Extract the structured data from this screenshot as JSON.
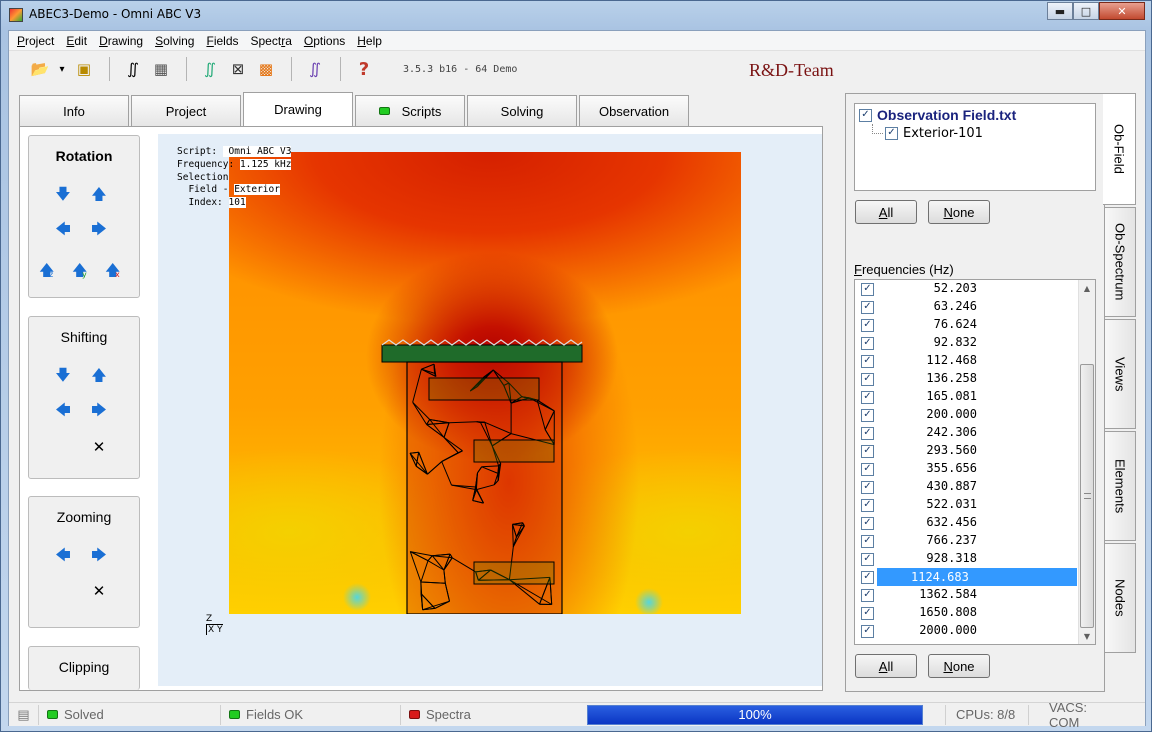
{
  "window": {
    "title": "ABEC3-Demo - Omni ABC V3",
    "controls": {
      "minimize": "▬",
      "maximize": "□",
      "close": "✕"
    }
  },
  "menu": [
    {
      "pre": "",
      "u": "P",
      "post": "roject"
    },
    {
      "pre": "",
      "u": "E",
      "post": "dit"
    },
    {
      "pre": "",
      "u": "D",
      "post": "rawing"
    },
    {
      "pre": "",
      "u": "S",
      "post": "olving"
    },
    {
      "pre": "",
      "u": "F",
      "post": "ields"
    },
    {
      "pre": "Spect",
      "u": "r",
      "post": "a"
    },
    {
      "pre": "",
      "u": "O",
      "post": "ptions"
    },
    {
      "pre": "",
      "u": "H",
      "post": "elp"
    }
  ],
  "toolbar": {
    "icons": [
      "open-folder-icon",
      "dropdown-icon",
      "save-icon",
      "integrate-icon",
      "mesh-icon",
      "spectra-icon",
      "grid-icon",
      "field-color-icon",
      "solve-curve-icon",
      "help-icon"
    ],
    "glyphs": {
      "open": "📂",
      "dropdown": "▾",
      "save": "▣",
      "integrate": "∬",
      "mesh": "▦",
      "spectra": "∬",
      "grid": "⊠",
      "field": "▩",
      "solve": "∬",
      "help": "?"
    },
    "version": "3.5.3 b16 - 64 Demo",
    "brand": "R&D-Team"
  },
  "tabs": [
    "Info",
    "Project",
    "Drawing",
    "Scripts",
    "Solving",
    "Observation"
  ],
  "active_tab": "Drawing",
  "controls": {
    "rotation": {
      "title": "Rotation",
      "up": "🡇",
      "down": "🡅",
      "left": "🡄",
      "right": "🡆",
      "axes": [
        "z",
        "y",
        "x"
      ],
      "axis_glyph": "🡅"
    },
    "shifting": {
      "title": "Shifting",
      "reset": "✕"
    },
    "zooming": {
      "title": "Zooming",
      "reset": "✕"
    },
    "clipping": {
      "title": "Clipping"
    }
  },
  "viewport": {
    "script_label": "Script:",
    "script_value": " Omni ABC V3",
    "frequency_label": "Frequency:",
    "frequency_value": "1.125 kHz",
    "selection_label": "Selection",
    "field_label": "  Field - ",
    "field_value": "Exterior",
    "index_label": "  Index:",
    "index_value": "101",
    "axis_z": "Z",
    "axis_xy": "X Y"
  },
  "observation": {
    "root": "Observation Field.txt",
    "child": "Exterior-101",
    "all_u": "A",
    "all_rest": "ll",
    "none_u": "N",
    "none_rest": "one"
  },
  "frequencies": {
    "label": "Frequencies  (Hz)",
    "label_u": "F",
    "label_rest": "requencies  (Hz)",
    "values": [
      "52.203",
      "63.246",
      "76.624",
      "92.832",
      "112.468",
      "136.258",
      "165.081",
      "200.000",
      "242.306",
      "293.560",
      "355.656",
      "430.887",
      "522.031",
      "632.456",
      "766.237",
      "928.318",
      "1124.683",
      "1362.584",
      "1650.808",
      "2000.000"
    ],
    "selected": "1124.683",
    "scroll_up": "▲",
    "scroll_down": "▼"
  },
  "side_tabs": [
    "Ob-Field",
    "Ob-Spectrum",
    "Views",
    "Elements",
    "Nodes"
  ],
  "status": {
    "solved": "Solved",
    "fields": "Fields OK",
    "spectra": "Spectra",
    "progress": "100%",
    "progress_value": 1.0,
    "cpus": "CPUs: 8/8",
    "vacs": "VACS: COM"
  },
  "colors": {
    "accent": "#3399ff",
    "brand": "#7a1212",
    "led_green": "#22cc22",
    "led_red": "#d81b1b",
    "progress": "#1642d0"
  }
}
